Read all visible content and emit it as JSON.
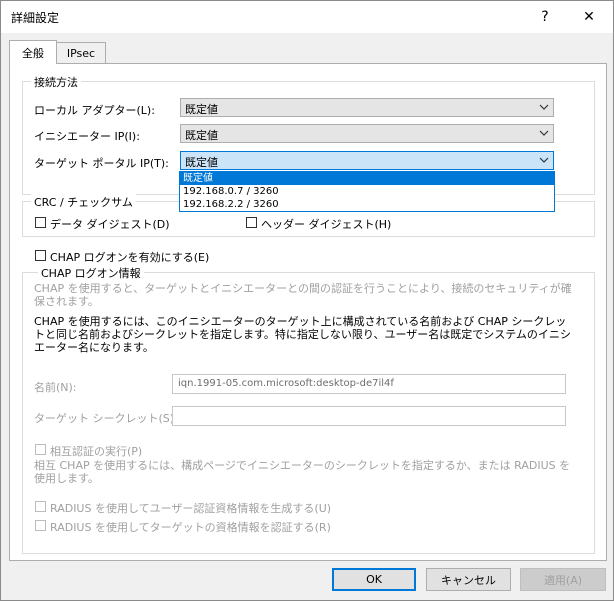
{
  "window": {
    "title": "詳細設定",
    "help": "?",
    "close": "✕"
  },
  "tabs": [
    {
      "label": "全般"
    },
    {
      "label": "IPsec"
    }
  ],
  "connection": {
    "legend": "接続方法",
    "local_adapter_label": "ローカル アダプター(L):",
    "local_adapter_value": "既定値",
    "initiator_ip_label": "イニシエーター IP(I):",
    "initiator_ip_value": "既定値",
    "target_portal_label": "ターゲット ポータル IP(T):",
    "target_portal_value": "既定値",
    "target_portal_options": [
      "既定値",
      "192.168.0.7 / 3260",
      "192.168.2.2 / 3260"
    ]
  },
  "crc": {
    "legend": "CRC / チェックサム",
    "data_digest": "データ ダイジェスト(D)",
    "header_digest": "ヘッダー ダイジェスト(H)"
  },
  "chap": {
    "enable_label": "CHAP ログオンを有効にする(E)",
    "legend": "CHAP ログオン情報",
    "desc1": "CHAP を使用すると、ターゲットとイニシエーターとの間の認証を行うことにより、接続のセキュリティが確保されます。",
    "desc2": "CHAP を使用するには、このイニシエーターのターゲット上に構成されている名前および CHAP シークレットと同じ名前およびシークレットを指定します。特に指定しない限り、ユーザー名は既定でシステムのイニシエーター名になります。",
    "name_label": "名前(N):",
    "name_value": "iqn.1991-05.com.microsoft:desktop-de7il4f",
    "secret_label": "ターゲット シークレット(S):",
    "secret_value": "",
    "mutual_label": "相互認証の実行(P)",
    "mutual_desc": "相互 CHAP を使用するには、構成ページでイニシエーターのシークレットを指定するか、または RADIUS を使用します。",
    "radius_user": "RADIUS を使用してユーザー認証資格情報を生成する(U)",
    "radius_target": "RADIUS を使用してターゲットの資格情報を認証する(R)"
  },
  "buttons": {
    "ok": "OK",
    "cancel": "キャンセル",
    "apply": "適用(A)"
  },
  "colors": {
    "accent": "#0078d7",
    "highlight": "#cce4f7"
  }
}
